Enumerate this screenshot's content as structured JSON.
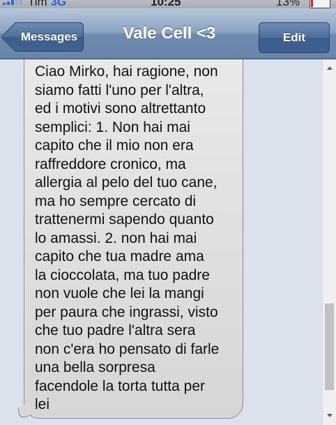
{
  "status_bar": {
    "carrier": "Tim",
    "network": "3G",
    "time": "10:25",
    "battery": "13%",
    "battery_level": 0.13,
    "signal_icon": "signal-bars-icon",
    "battery_icon": "battery-icon"
  },
  "nav": {
    "back_label": "Messages",
    "title": "Vale Cell <3",
    "edit_label": "Edit"
  },
  "conversation": {
    "message_text": "Ciao Mirko, hai ragione, non\nsiamo fatti l'uno per l'altra,\ned i motivi sono altrettanto\nsemplici: 1. Non hai mai\ncapito che il mio non era\nraffreddore cronico, ma\nallergia al pelo del tuo cane,\nma ho sempre cercato di\ntrattenermi sapendo quanto\nlo amassi. 2. non hai mai\ncapito che tua madre ama\nla cioccolata, ma tuo padre\nnon vuole che lei la mangi\nper paura che ingrassi, visto\nche tuo padre l'altra sera\nnon c'era ho pensato di farle\nuna bella sorpresa\nfacendole la torta tutta per\nlei"
  },
  "colors": {
    "nav_bar": "#6d89ae",
    "bubble": "#e0e0e0",
    "background": "#dbe2ed"
  }
}
